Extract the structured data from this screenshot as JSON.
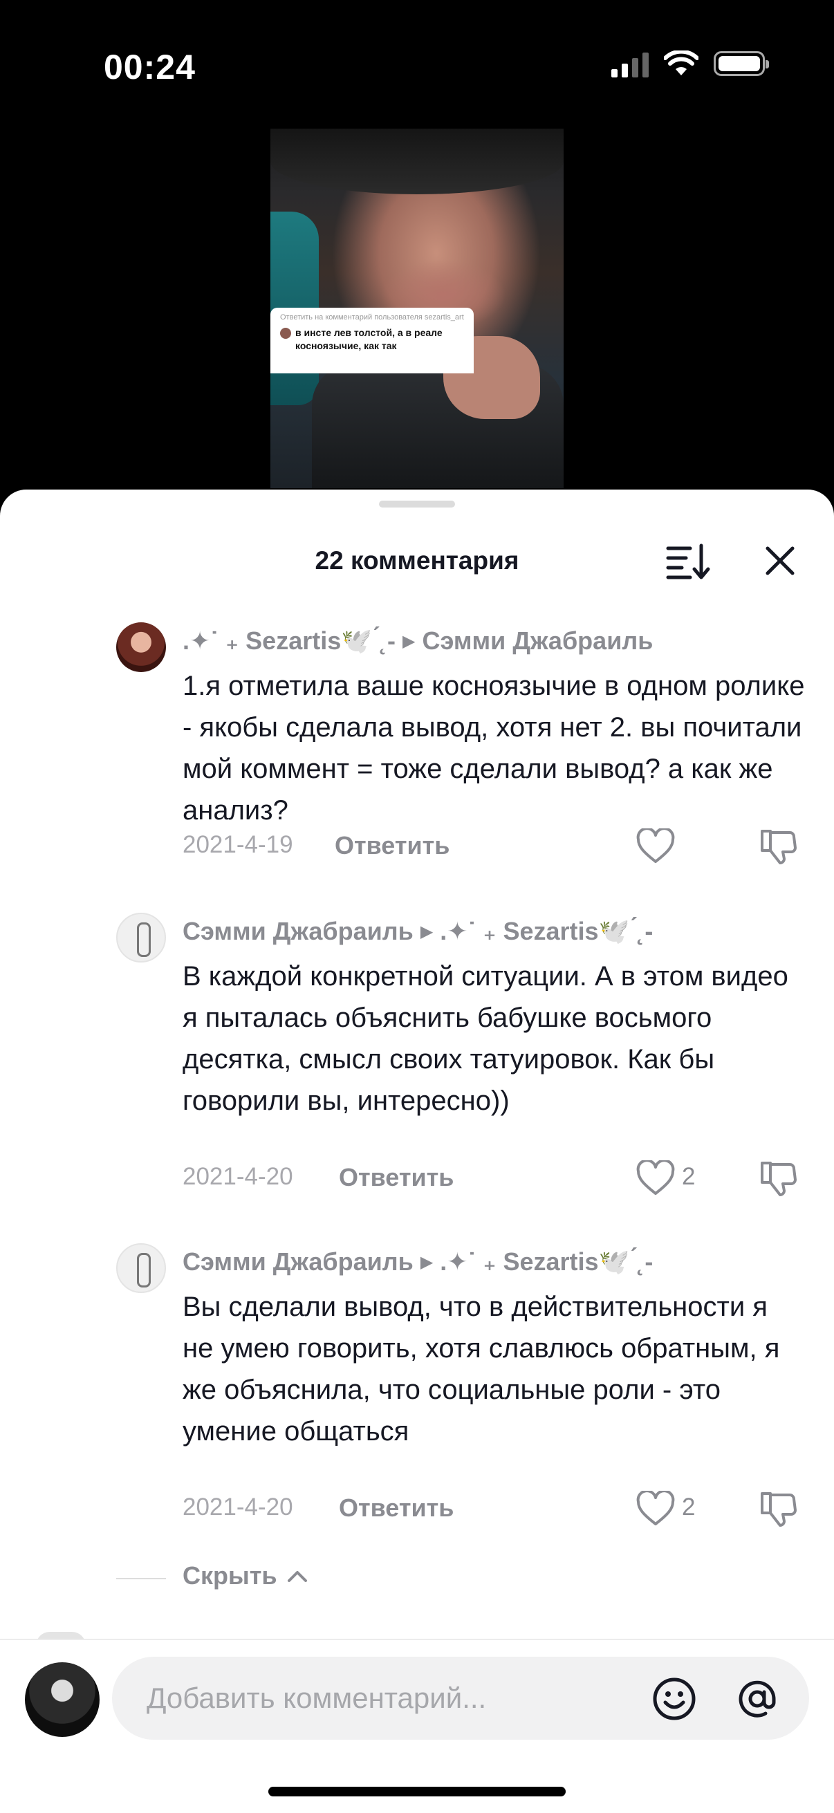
{
  "status_bar": {
    "time": "00:24"
  },
  "video": {
    "reply_bubble": {
      "header": "Ответить на комментарий пользователя sezartis_art",
      "text": "в инсте лев толстой, а в реале косноязычие, как так"
    }
  },
  "comments_sheet": {
    "title": "22 комментария",
    "icons": {
      "sort": "sort-icon",
      "close": "close-icon"
    },
    "comments": [
      {
        "author": ".✦˙ ₊ Sezartis🕊️ ́˛-",
        "reply_to": "Сэмми Джабраиль",
        "text": "1.я отметила ваше косноязычие в одном ролике - якобы сделала вывод, хотя нет 2. вы почитали мой коммент = тоже сделали вывод? а как же анализ?",
        "date": "2021-4-19",
        "reply_label": "Ответить",
        "likes": ""
      },
      {
        "author": "Сэмми Джабраиль",
        "reply_to": ".✦˙ ₊ Sezartis🕊️ ́˛-",
        "text": "В каждой конкретной ситуации. А в этом видео я пыталась объяснить бабушке восьмого десятка, смысл своих татуировок. Как бы говорили вы, интересно))",
        "date": "2021-4-20",
        "reply_label": "Ответить",
        "likes": "2"
      },
      {
        "author": "Сэмми Джабраиль",
        "reply_to": ".✦˙ ₊ Sezartis🕊️ ́˛-",
        "text": "Вы сделали вывод, что в действительности я не умею говорить, хотя славлюсь обратным, я же объяснила, что социальные роли - это умение общаться",
        "date": "2021-4-20",
        "reply_label": "Ответить",
        "likes": "2"
      }
    ],
    "hide_label": "Скрыть"
  },
  "input_bar": {
    "placeholder": "Добавить комментарий...",
    "icons": {
      "emoji": "emoji-icon",
      "mention": "at-icon"
    }
  }
}
